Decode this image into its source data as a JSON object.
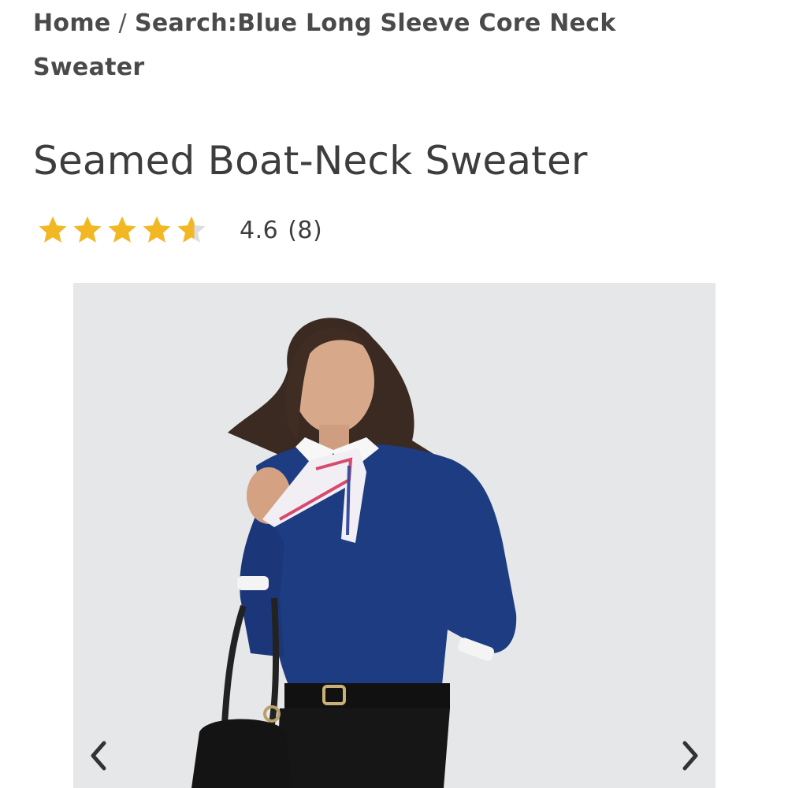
{
  "breadcrumb": {
    "home_label": "Home",
    "separator": "/",
    "search_label": "Search:Blue Long Sleeve Core Neck Sweater"
  },
  "product": {
    "title": "Seamed Boat-Neck Sweater",
    "rating": {
      "value": 4.6,
      "value_text": "4.6",
      "count_text": "(8)",
      "max_stars": 5,
      "star_color": "#f2b824",
      "star_empty_color": "#dddddd"
    }
  },
  "gallery": {
    "prev_icon": "chevron-left-icon",
    "next_icon": "chevron-right-icon",
    "background_color": "#e6e7e8",
    "sweater_color": "#1e3c82"
  }
}
